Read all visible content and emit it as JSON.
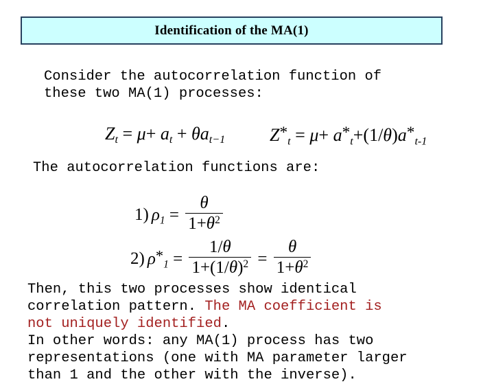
{
  "slide": {
    "title": "Identification of the MA(1)",
    "intro_text": "Consider the autocorrelation function of\nthese two MA(1) processes:",
    "acf_lead_text": "The autocorrelation functions are:",
    "conclusion": {
      "part_black_1": "Then, this two processes show identical\ncorrelation pattern. ",
      "part_red": "The MA coefficient is\nnot uniquely identified",
      "part_black_2": ".\nIn other words: any MA(1) process has two\nrepresentations (one with MA parameter larger\nthan 1 and the other with the inverse)."
    }
  },
  "equations": {
    "process_1": {
      "lhs_var": "Z",
      "lhs_sub": "t",
      "eq": "=",
      "mu": "μ",
      "plus": "+",
      "a": "a",
      "a_sub": "t",
      "theta": "θ",
      "a2": "a",
      "a2_sub": "t−1"
    },
    "process_2": {
      "lhs_var": "Z",
      "star": "*",
      "lhs_sub": "t",
      "eq": "=",
      "mu": "μ",
      "plus": "+",
      "a": "a",
      "a_sub": "t",
      "coef_open": "+(1/",
      "theta": "θ",
      "coef_close": ")",
      "a2": "a",
      "a2_sub": "t-1"
    }
  },
  "formulas": {
    "rho_1": {
      "number": "1)",
      "symbol": "ρ",
      "sub": "1",
      "eq": "=",
      "numerator": "θ",
      "denominator_pre": "1+",
      "denominator_theta": "θ",
      "denominator_sup": "2"
    },
    "rho_star_1": {
      "number": "2)",
      "symbol": "ρ",
      "star": "*",
      "sub": "1",
      "eq1": "=",
      "numerator_1": "1/",
      "numerator_1_theta": "θ",
      "denominator_1_pre": "1+(1/",
      "denominator_1_theta": "θ",
      "denominator_1_post": ")",
      "denominator_1_sup": "2",
      "eq2": "=",
      "numerator_2": "θ",
      "denominator_2_pre": "1+",
      "denominator_2_theta": "θ",
      "denominator_2_sup": "2"
    }
  },
  "colors": {
    "title_fill": "#ccffff",
    "title_border": "#27405e",
    "highlight_red": "#a32020",
    "text_black": "#000000",
    "background": "#ffffff"
  }
}
